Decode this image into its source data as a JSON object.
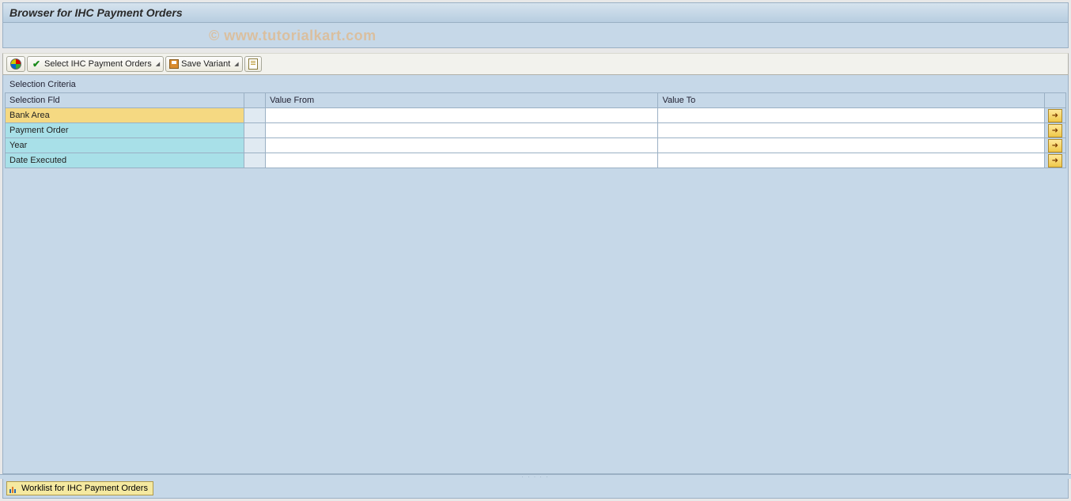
{
  "title": "Browser for IHC Payment Orders",
  "watermark": "© www.tutorialkart.com",
  "toolbar": {
    "select_label": "Select IHC Payment Orders",
    "save_variant_label": "Save Variant"
  },
  "section_label": "Selection Criteria",
  "columns": {
    "fld": "Selection Fld",
    "from": "Value From",
    "to": "Value To"
  },
  "rows": [
    {
      "fld": "Bank Area",
      "from": "",
      "to": "",
      "selected": true
    },
    {
      "fld": "Payment Order",
      "from": "",
      "to": "",
      "selected": false
    },
    {
      "fld": "Year",
      "from": "",
      "to": "",
      "selected": false
    },
    {
      "fld": "Date Executed",
      "from": "",
      "to": "",
      "selected": false
    }
  ],
  "bottom_tab": "Worklist for IHC Payment Orders"
}
